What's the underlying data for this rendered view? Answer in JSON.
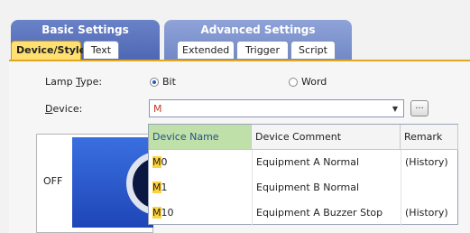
{
  "groups": {
    "basic_title": "Basic Settings",
    "advanced_title": "Advanced Settings"
  },
  "tabs": {
    "device_style": "Device/Style*",
    "text": "Text",
    "extended": "Extended",
    "trigger": "Trigger",
    "script": "Script"
  },
  "form": {
    "lamp_type_label_prefix": "Lamp ",
    "lamp_type_label_key": "T",
    "lamp_type_label_suffix": "ype:",
    "bit_label": "Bit",
    "word_label": "Word",
    "device_label_key": "D",
    "device_label_suffix": "evice:",
    "device_value": "M",
    "ellipsis_label": "..."
  },
  "preview": {
    "off_label": "OFF"
  },
  "dropdown": {
    "headers": {
      "name": "Device Name",
      "comment": "Device Comment",
      "remark": "Remark"
    },
    "rows": [
      {
        "name_prefix": "M",
        "name_rest": "0",
        "comment": "Equipment A Normal",
        "remark": "(History)"
      },
      {
        "name_prefix": "M",
        "name_rest": "1",
        "comment": "Equipment B Normal",
        "remark": ""
      },
      {
        "name_prefix": "M",
        "name_rest": "10",
        "comment": "Equipment A Buzzer Stop",
        "remark": "(History)"
      }
    ]
  }
}
